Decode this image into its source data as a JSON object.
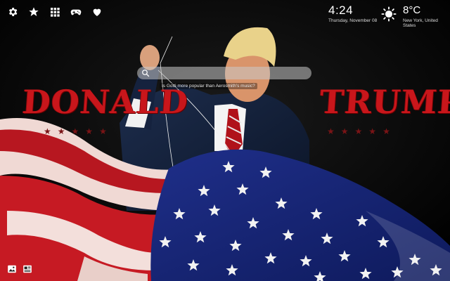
{
  "toolbar": {
    "icons": [
      "gear-icon",
      "star-icon",
      "apps-grid-icon",
      "gamepad-icon",
      "heart-icon"
    ]
  },
  "clock": {
    "time": "4:24",
    "date": "Thursday, November 08"
  },
  "weather": {
    "temperature": "8°C",
    "location": "New York, United States",
    "icon": "sun-icon"
  },
  "search": {
    "placeholder": ""
  },
  "fact": {
    "text": "Is Gotti more popular than Aerosmith's music?"
  },
  "headline": {
    "first": "DONALD",
    "last": "TRUMP",
    "stars": [
      "★",
      "★",
      "★",
      "★",
      "★"
    ]
  },
  "colors": {
    "headline_red": "#c8161b",
    "star_red": "#7a1416"
  },
  "bottom": {
    "icons": [
      "image-icon",
      "news-icon"
    ]
  }
}
